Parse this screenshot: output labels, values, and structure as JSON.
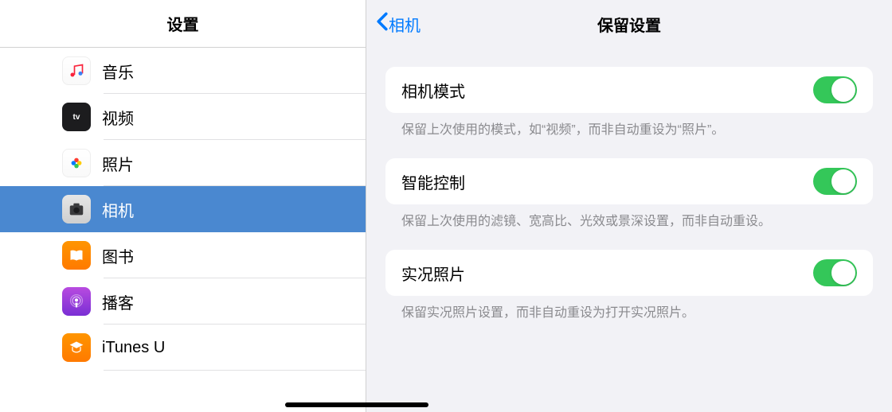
{
  "left": {
    "title": "设置",
    "items": [
      {
        "key": "music",
        "label": "音乐"
      },
      {
        "key": "video",
        "label": "视频"
      },
      {
        "key": "photos",
        "label": "照片"
      },
      {
        "key": "camera",
        "label": "相机"
      },
      {
        "key": "books",
        "label": "图书"
      },
      {
        "key": "podcast",
        "label": "播客"
      },
      {
        "key": "itunesu",
        "label": "iTunes U"
      }
    ],
    "selected": "camera"
  },
  "right": {
    "back_label": "相机",
    "title": "保留设置",
    "groups": [
      {
        "label": "相机模式",
        "footer": "保留上次使用的模式，如“视频”，而非自动重设为“照片”。",
        "on": true
      },
      {
        "label": "智能控制",
        "footer": "保留上次使用的滤镜、宽高比、光效或景深设置，而非自动重设。",
        "on": true
      },
      {
        "label": "实况照片",
        "footer": "保留实况照片设置，而非自动重设为打开实况照片。",
        "on": true
      }
    ]
  }
}
